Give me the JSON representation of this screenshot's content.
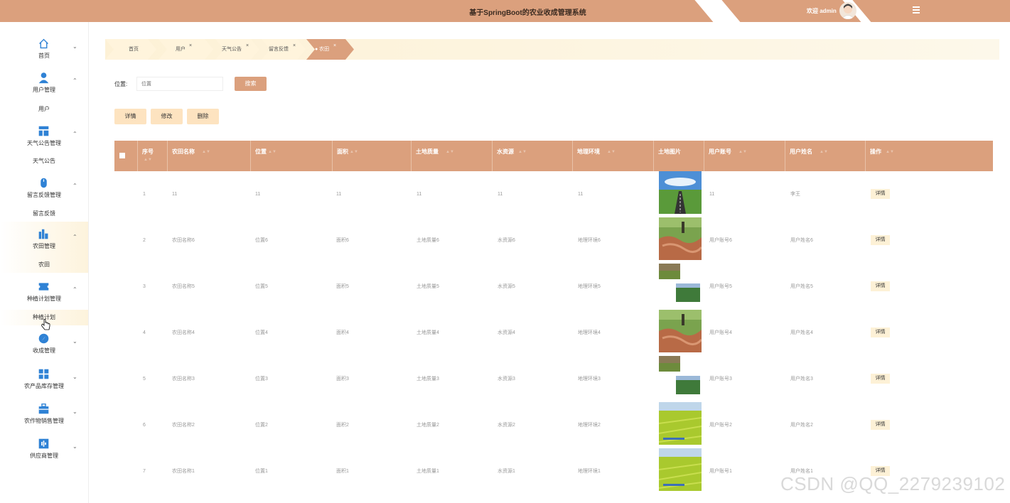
{
  "header": {
    "title": "基于SpringBoot的农业收成管理系统",
    "welcome": "欢迎 admin"
  },
  "sidebar": {
    "items": [
      {
        "label": "首页",
        "icon": "home-icon"
      },
      {
        "label": "用户管理",
        "icon": "user-icon",
        "sub": "用户"
      },
      {
        "label": "天气公告管理",
        "icon": "layout-icon",
        "sub": "天气公告"
      },
      {
        "label": "留言反馈管理",
        "icon": "mouse-icon",
        "sub": "留言反馈"
      },
      {
        "label": "农田管理",
        "icon": "chart-icon",
        "sub": "农田"
      },
      {
        "label": "种植计划管理",
        "icon": "ticket-icon",
        "sub": "种植计划"
      },
      {
        "label": "收成管理",
        "icon": "compass-icon"
      },
      {
        "label": "农产品库存管理",
        "icon": "grid-icon"
      },
      {
        "label": "农作物销售管理",
        "icon": "briefcase-icon"
      },
      {
        "label": "供应商管理",
        "icon": "bar-icon"
      }
    ]
  },
  "breadcrumb": [
    "首页",
    "用户",
    "天气公告",
    "留言反馈",
    "● 农田"
  ],
  "search": {
    "label": "位置:",
    "placeholder": "位置",
    "button": "搜索"
  },
  "actions": {
    "detail": "详情",
    "edit": "修改",
    "delete": "删除"
  },
  "table": {
    "headers": [
      "序号",
      "农田名称",
      "位置",
      "面积",
      "土地质量",
      "水资源",
      "地理环境",
      "土地图片",
      "用户账号",
      "用户姓名",
      "操作"
    ],
    "detail_label": "详情",
    "rows": [
      {
        "no": "1",
        "name": "11",
        "location": "11",
        "area": "11",
        "quality": "11",
        "water": "11",
        "env": "11",
        "account": "11",
        "username": "李王",
        "img": "road"
      },
      {
        "no": "2",
        "name": "农田名称6",
        "location": "位置6",
        "area": "面积6",
        "quality": "土地质量6",
        "water": "水资源6",
        "env": "地理环境6",
        "account": "用户账号6",
        "username": "用户姓名6",
        "img": "farm"
      },
      {
        "no": "3",
        "name": "农田名称5",
        "location": "位置5",
        "area": "面积5",
        "quality": "土地质量5",
        "water": "水资源5",
        "env": "地理环境5",
        "account": "用户账号5",
        "username": "用户姓名5",
        "img": "split"
      },
      {
        "no": "4",
        "name": "农田名称4",
        "location": "位置4",
        "area": "面积4",
        "quality": "土地质量4",
        "water": "水资源4",
        "env": "地理环境4",
        "account": "用户账号4",
        "username": "用户姓名4",
        "img": "farm"
      },
      {
        "no": "5",
        "name": "农田名称3",
        "location": "位置3",
        "area": "面积3",
        "quality": "土地质量3",
        "water": "水资源3",
        "env": "地理环境3",
        "account": "用户账号3",
        "username": "用户姓名3",
        "img": "split"
      },
      {
        "no": "6",
        "name": "农田名称2",
        "location": "位置2",
        "area": "面积2",
        "quality": "土地质量2",
        "water": "水资源2",
        "env": "地理环境2",
        "account": "用户账号2",
        "username": "用户姓名2",
        "img": "green"
      },
      {
        "no": "7",
        "name": "农田名称1",
        "location": "位置1",
        "area": "面积1",
        "quality": "土地质量1",
        "water": "水资源1",
        "env": "地理环境1",
        "account": "用户账号1",
        "username": "用户姓名1",
        "img": "green"
      }
    ]
  },
  "watermark": "CSDN @QQ_2279239102",
  "colors": {
    "brand": "#dba07d",
    "highlight": "#fdf1d6",
    "icon": "#2f82d5"
  }
}
